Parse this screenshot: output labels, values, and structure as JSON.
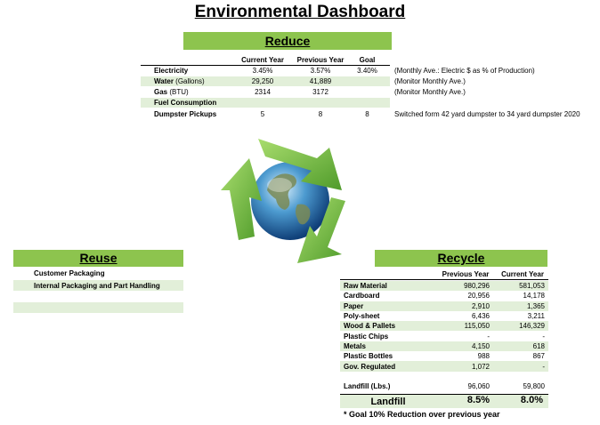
{
  "title": "Environmental Dashboard",
  "reduce": {
    "header": "Reduce",
    "columns": [
      "Current Year",
      "Previous Year",
      "Goal"
    ],
    "rows": [
      {
        "label": "Electricity",
        "current": "3.45%",
        "previous": "3.57%",
        "goal": "3.40%",
        "note": "(Monthly Ave.: Electric $ as % of Production)"
      },
      {
        "label": "Water",
        "unit": " (Gallons)",
        "current": "29,250",
        "previous": "41,889",
        "goal": "",
        "note": "(Monitor Monthly Ave.)"
      },
      {
        "label": "Gas",
        "unit": " (BTU)",
        "current": "2314",
        "previous": "3172",
        "goal": "",
        "note": "(Monitor Monthly Ave.)"
      },
      {
        "label": "Fuel Consumption",
        "current": "",
        "previous": "",
        "goal": "",
        "note": ""
      },
      {
        "label": "Dumpster Pickups",
        "current": "5",
        "previous": "8",
        "goal": "8",
        "note": "Switched form 42 yard dumpster to 34 yard dumpster 2020"
      }
    ]
  },
  "reuse": {
    "header": "Reuse",
    "items": [
      "Customer Packaging",
      "Internal Packaging and Part Handling",
      ""
    ]
  },
  "recycle": {
    "header": "Recycle",
    "columns": [
      "Previous Year",
      "Current Year"
    ],
    "rows": [
      {
        "label": "Raw Material",
        "previous": "980,296",
        "current": "581,053"
      },
      {
        "label": "Cardboard",
        "previous": "20,956",
        "current": "14,178"
      },
      {
        "label": "Paper",
        "previous": "2,910",
        "current": "1,365"
      },
      {
        "label": "Poly-sheet",
        "previous": "6,436",
        "current": "3,211"
      },
      {
        "label": "Wood & Pallets",
        "previous": "115,050",
        "current": "146,329"
      },
      {
        "label": "Plastic Chips",
        "previous": "-",
        "current": "-"
      },
      {
        "label": "Metals",
        "previous": "4,150",
        "current": "618"
      },
      {
        "label": "Plastic Bottles",
        "previous": "988",
        "current": "867"
      },
      {
        "label": "Gov. Regulated",
        "previous": "1,072",
        "current": "-"
      }
    ],
    "landfill_lbs": {
      "label": "Landfill (Lbs.)",
      "previous": "96,060",
      "current": "59,800"
    },
    "landfill_pct": {
      "label": "Landfill",
      "previous": "8.5%",
      "current": "8.0%"
    },
    "footnote": "* Goal 10% Reduction over previous year"
  },
  "colors": {
    "band": "#8dc44e",
    "band_light": "#e2efd9",
    "arrow": "#6cb23e"
  },
  "icon": "recycle-globe-icon"
}
